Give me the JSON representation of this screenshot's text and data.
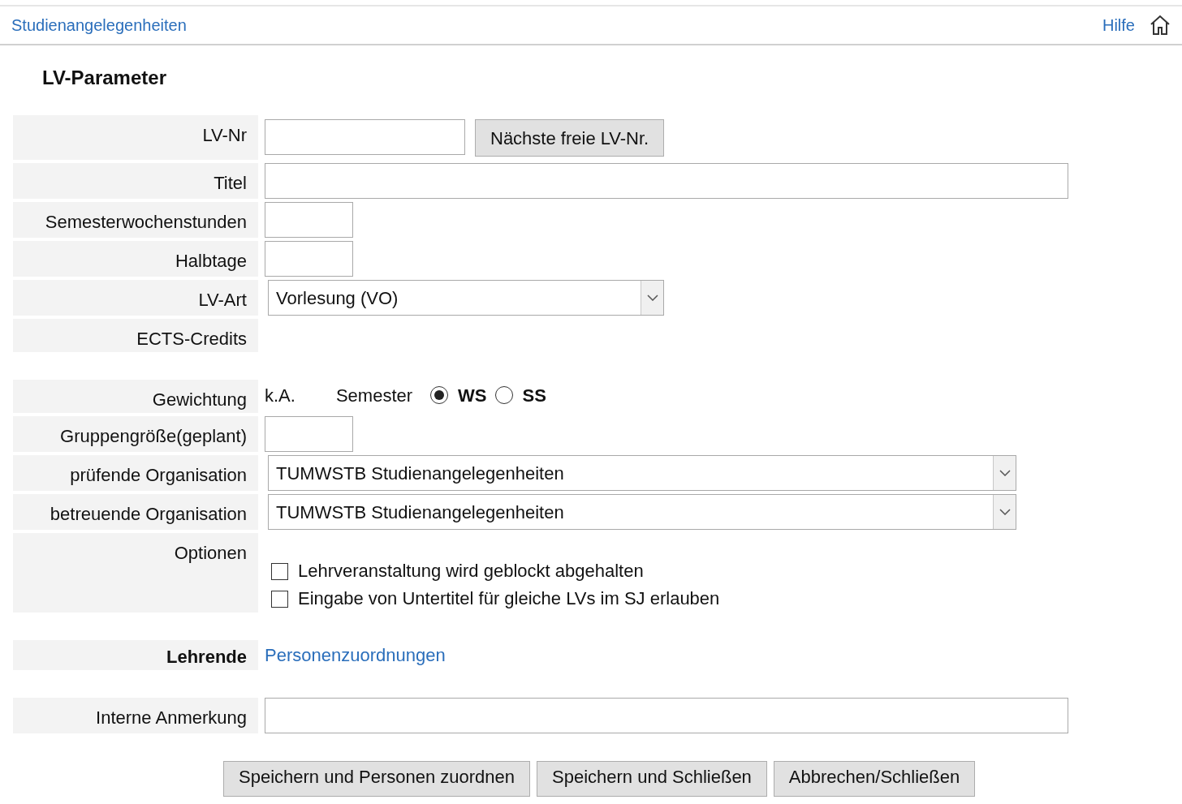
{
  "header": {
    "breadcrumb": "Studienangelegenheiten",
    "help": "Hilfe"
  },
  "title": "LV-Parameter",
  "sections": [
    [
      {
        "kind": "input-with-button",
        "label": "LV-Nr",
        "button": "Nächste freie LV-Nr."
      },
      {
        "kind": "wide-input",
        "label": "Titel"
      },
      {
        "kind": "short-input",
        "label": "Semesterwochenstunden"
      },
      {
        "kind": "short-input",
        "label": "Halbtage"
      },
      {
        "kind": "select",
        "label": "LV-Art",
        "value": "Vorlesung (VO)"
      },
      {
        "kind": "empty",
        "label": "ECTS-Credits"
      }
    ],
    [
      {
        "kind": "weighting",
        "label": "Gewichtung",
        "value": "k.A.",
        "semester_label": "Semester",
        "options": [
          {
            "label": "WS",
            "selected": true
          },
          {
            "label": "SS",
            "selected": false
          }
        ]
      },
      {
        "kind": "short-input",
        "label": "Gruppengröße(geplant)"
      },
      {
        "kind": "wide-select",
        "label": "prüfende Organisation",
        "value": "TUMWSTB Studienangelegenheiten"
      },
      {
        "kind": "wide-select",
        "label": "betreuende Organisation",
        "value": "TUMWSTB Studienangelegenheiten"
      },
      {
        "kind": "checkboxes",
        "label": "Optionen",
        "options": [
          {
            "label": "Lehrveranstaltung wird geblockt abgehalten",
            "checked": false
          },
          {
            "label": "Eingabe von Untertitel für gleiche LVs im SJ erlauben",
            "checked": false
          }
        ]
      }
    ],
    [
      {
        "kind": "link",
        "label": "Lehrende",
        "link": "Personenzuordnungen"
      }
    ],
    [
      {
        "kind": "wide-input",
        "label": "Interne Anmerkung"
      }
    ]
  ],
  "buttons": [
    "Speichern und Personen zuordnen",
    "Speichern und Schließen",
    "Abbrechen/Schließen"
  ]
}
